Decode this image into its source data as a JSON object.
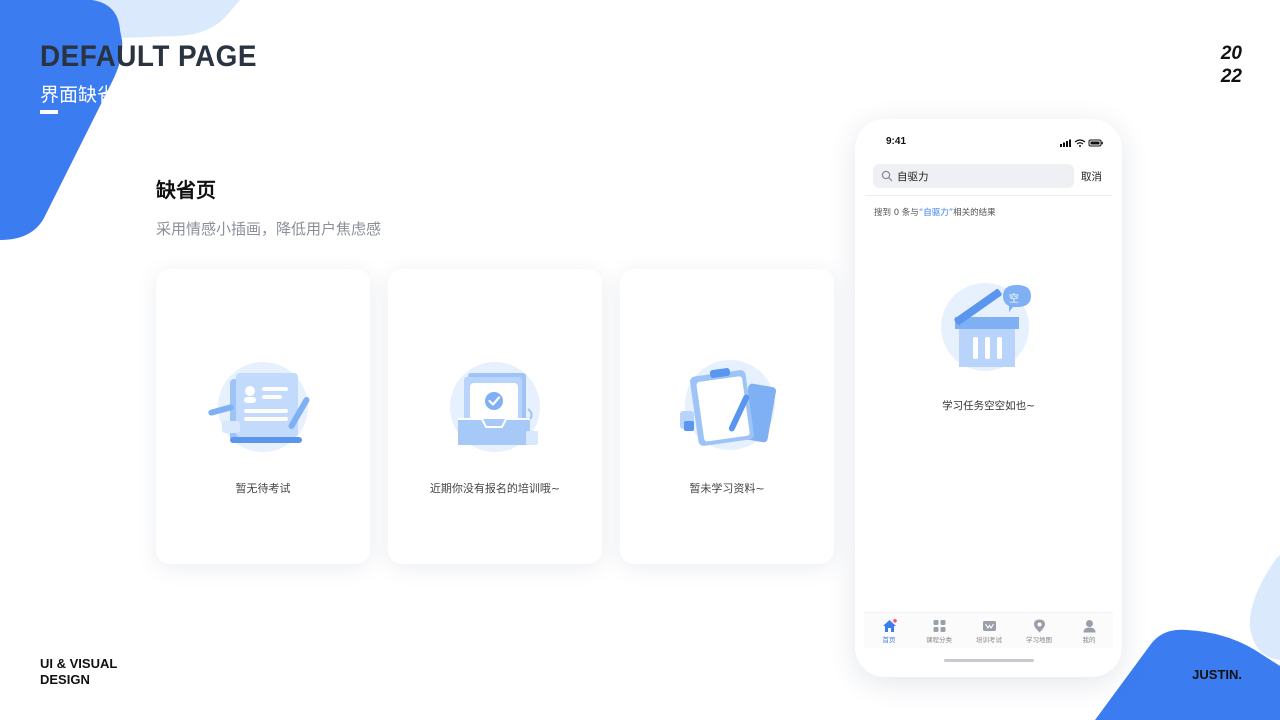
{
  "header": {
    "title": "DEFAULT PAGE",
    "subtitle": "界面缺省页",
    "year_top": "20",
    "year_bottom": "22"
  },
  "footer": {
    "left_line1": "UI & VISUAL",
    "left_line2": "DESIGN",
    "right": "JUSTIN."
  },
  "section": {
    "title": "缺省页",
    "description": "采用情感小插画，降低用户焦虑感"
  },
  "cards": [
    {
      "caption": "暂无待考试",
      "icon": "exam-illustration-icon"
    },
    {
      "caption": "近期你没有报名的培训哦~",
      "icon": "training-illustration-icon"
    },
    {
      "caption": "暂未学习资料~",
      "icon": "clipboard-illustration-icon"
    }
  ],
  "phone": {
    "status_time": "9:41",
    "search": {
      "value": "自驱力"
    },
    "cancel_label": "取消",
    "result": {
      "prefix": "搜到 0 条与",
      "keyword": "“自驱力”",
      "suffix": "相关的结果"
    },
    "empty_bubble": "空",
    "empty_caption": "学习任务空空如也~",
    "tabs": [
      {
        "label": "首页",
        "icon": "home-icon",
        "active": true
      },
      {
        "label": "课程分类",
        "icon": "grid-icon",
        "active": false
      },
      {
        "label": "培训考试",
        "icon": "exam-icon",
        "active": false
      },
      {
        "label": "学习地图",
        "icon": "location-pin-icon",
        "active": false
      },
      {
        "label": "我的",
        "icon": "user-icon",
        "active": false
      }
    ]
  },
  "colors": {
    "accent": "#3b7cf0",
    "light_accent": "#dbe9fd",
    "badge": "#f05a5a"
  }
}
